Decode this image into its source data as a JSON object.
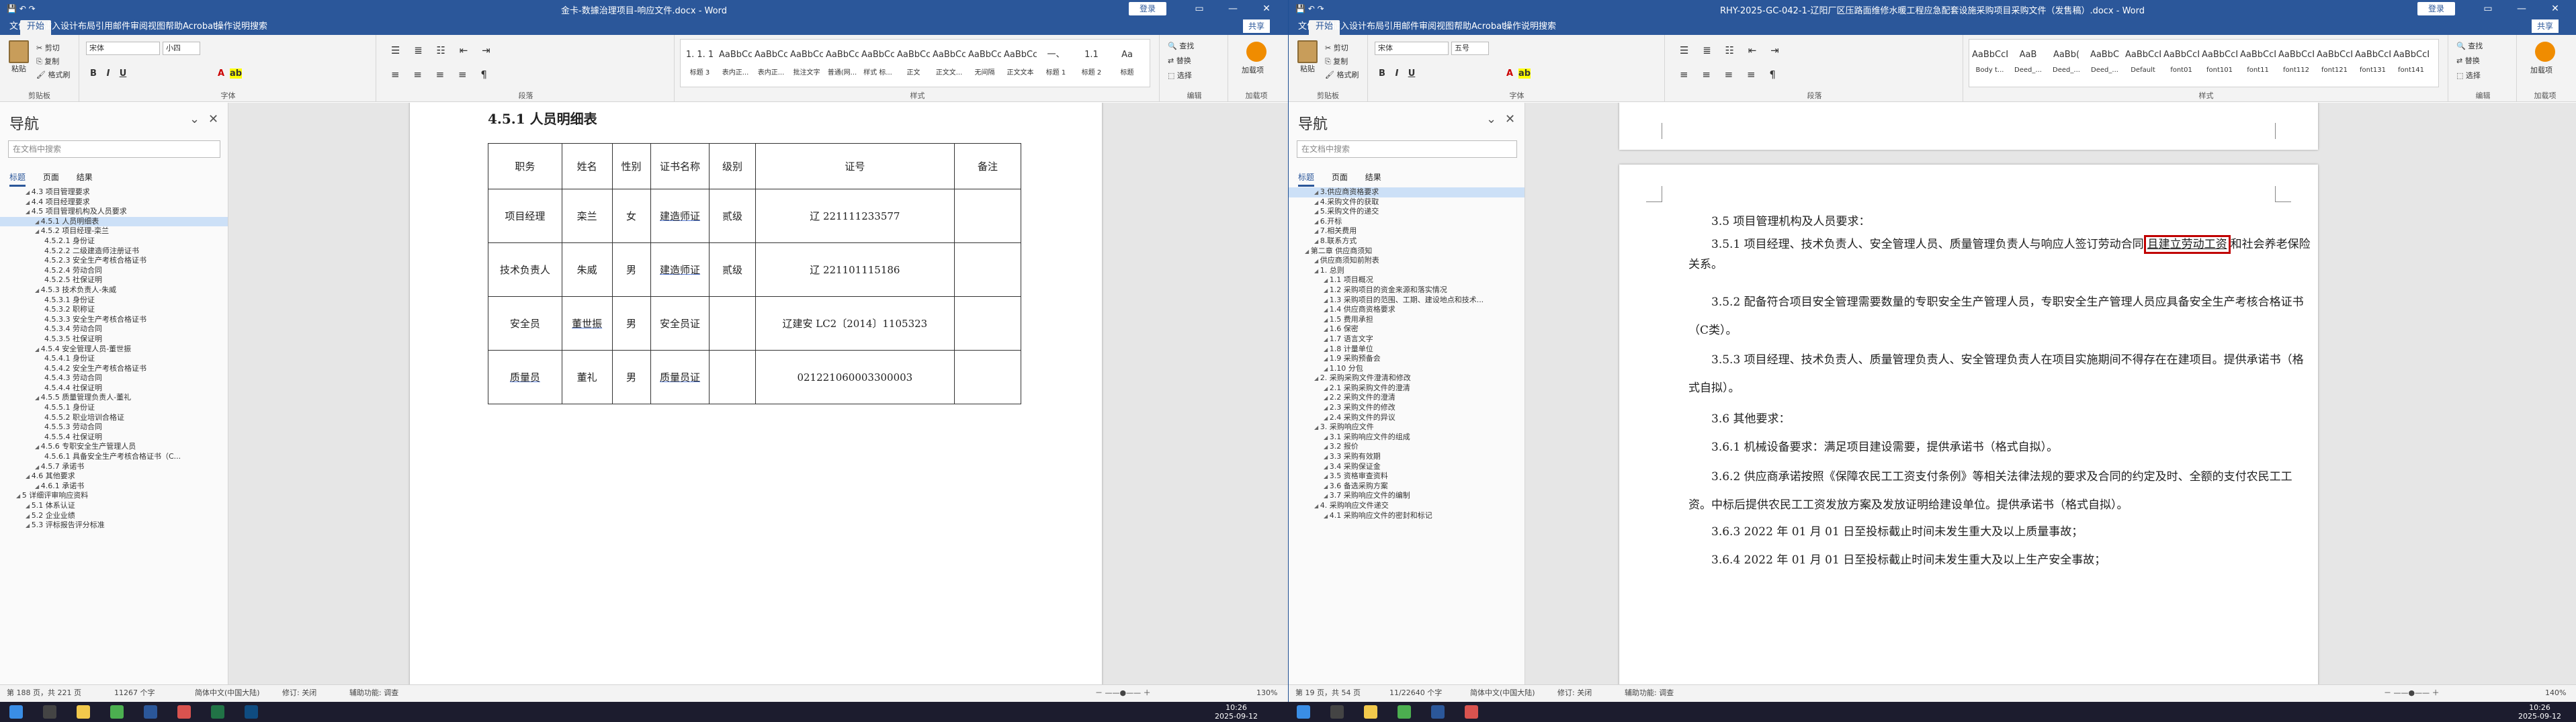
{
  "w1": {
    "title": "金卡-数據治理项目-响应文件.docx  -  Word",
    "login": "登录",
    "share": "共享",
    "tabs": [
      "文件",
      "开始",
      "插入",
      "设计",
      "布局",
      "引用",
      "邮件",
      "审阅",
      "视图",
      "帮助",
      "Acrobat",
      "操作说明搜索"
    ],
    "clipboard": {
      "paste": "粘贴",
      "cut": "剪切",
      "copy": "复制",
      "format_painter": "格式刷",
      "label": "剪贴板"
    },
    "font": {
      "name": "宋体",
      "size": "小四",
      "label": "字体"
    },
    "paragraph_label": "段落",
    "styles": [
      {
        "sample": "1. 1. 1",
        "name": "标题 3"
      },
      {
        "sample": "AaBbCcC",
        "name": "表内正..."
      },
      {
        "sample": "AaBbCcDd",
        "name": "表内正..."
      },
      {
        "sample": "AaBbCcDd",
        "name": "批注文字"
      },
      {
        "sample": "AaBbCcDd",
        "name": "普通(网..."
      },
      {
        "sample": "AaBbCcDd",
        "name": "样式 标..."
      },
      {
        "sample": "AaBbCcDd",
        "name": "正文"
      },
      {
        "sample": "AaBbCcDd",
        "name": "正文文..."
      },
      {
        "sample": "AaBbCcDd",
        "name": "无间隔"
      },
      {
        "sample": "AaBbCcDd",
        "name": "正文文本"
      },
      {
        "sample": "一、",
        "name": "标题 1"
      },
      {
        "sample": "1.1",
        "name": "标题 2"
      },
      {
        "sample": "Aa",
        "name": "标题"
      }
    ],
    "styles_label": "样式",
    "editing": {
      "find": "查找",
      "replace": "替换",
      "select": "选择",
      "label": "编辑"
    },
    "addin": {
      "name": "加载项",
      "label": "加载项"
    },
    "nav": {
      "title": "导航",
      "search_placeholder": "在文档中搜索",
      "tabs": [
        "标题",
        "页面",
        "结果"
      ],
      "items": [
        {
          "text": "4.3 项目管理要求",
          "level": 2
        },
        {
          "text": "4.4 项目经理要求",
          "level": 2
        },
        {
          "text": "4.5 项目管理机构及人员要求",
          "level": 2
        },
        {
          "text": "4.5.1 人员明细表",
          "level": 3,
          "selected": true
        },
        {
          "text": "4.5.2 项目经理-栾兰",
          "level": 3
        },
        {
          "text": "4.5.2.1 身份证",
          "level": 4
        },
        {
          "text": "4.5.2.2 二级建造师注册证书",
          "level": 4
        },
        {
          "text": "4.5.2.3 安全生产考核合格证书",
          "level": 4
        },
        {
          "text": "4.5.2.4 劳动合同",
          "level": 4
        },
        {
          "text": "4.5.2.5 社保证明",
          "level": 4
        },
        {
          "text": "4.5.3 技术负责人-朱威",
          "level": 3
        },
        {
          "text": "4.5.3.1 身份证",
          "level": 4
        },
        {
          "text": "4.5.3.2 职称证",
          "level": 4
        },
        {
          "text": "4.5.3.3 安全生产考核合格证书",
          "level": 4
        },
        {
          "text": "4.5.3.4 劳动合同",
          "level": 4
        },
        {
          "text": "4.5.3.5 社保证明",
          "level": 4
        },
        {
          "text": "4.5.4 安全管理人员-董世振",
          "level": 3
        },
        {
          "text": "4.5.4.1 身份证",
          "level": 4
        },
        {
          "text": "4.5.4.2 安全生产考核合格证书",
          "level": 4
        },
        {
          "text": "4.5.4.3 劳动合同",
          "level": 4
        },
        {
          "text": "4.5.4.4 社保证明",
          "level": 4
        },
        {
          "text": "4.5.5 质量管理负责人-董礼",
          "level": 3
        },
        {
          "text": "4.5.5.1 身份证",
          "level": 4
        },
        {
          "text": "4.5.5.2 职业培训合格证",
          "level": 4
        },
        {
          "text": "4.5.5.3 劳动合同",
          "level": 4
        },
        {
          "text": "4.5.5.4 社保证明",
          "level": 4
        },
        {
          "text": "4.5.6 专职安全生产管理人员",
          "level": 3
        },
        {
          "text": "4.5.6.1 具备安全生产考核合格证书（C...",
          "level": 4
        },
        {
          "text": "4.5.7 承诺书",
          "level": 3
        },
        {
          "text": "4.6 其他要求",
          "level": 2
        },
        {
          "text": "4.6.1 承诺书",
          "level": 3
        },
        {
          "text": "5 详细评审响应资料",
          "level": 1
        },
        {
          "text": "5.1 体系认证",
          "level": 2
        },
        {
          "text": "5.2 企业业绩",
          "level": 2
        },
        {
          "text": "5.3 评标报告评分标准",
          "level": 2
        }
      ]
    },
    "doc": {
      "heading": "4.5.1  人员明细表",
      "columns": [
        "职务",
        "姓名",
        "性别",
        "证书名称",
        "级别",
        "证号",
        "备注"
      ],
      "rows": [
        [
          "项目经理",
          "栾兰",
          "女",
          "建造师证",
          "贰级",
          "辽 221111233577",
          ""
        ],
        [
          "技术负责人",
          "朱威",
          "男",
          "建造师证",
          "贰级",
          "辽 221101115186",
          ""
        ],
        [
          "安全员",
          "董世振",
          "男",
          "安全员证",
          "",
          "辽建安 LC2〔2014〕1105323",
          ""
        ],
        [
          "质量员",
          "董礼",
          "男",
          "质量员证",
          "",
          "021221060003300003",
          ""
        ]
      ]
    },
    "status": {
      "page": "第 188 页，共 221 页",
      "words": "11267 个字",
      "lang": "简体中文(中国大陆)",
      "revision": "修订: 关闭",
      "access": "辅助功能: 调查",
      "zoom": "130%"
    }
  },
  "w2": {
    "title": "RHY-2025-GC-042-1-辽阳厂区压路面维修水暖工程应急配套设施采购项目采购文件（发售稿）.docx  -  Word",
    "login": "登录",
    "share": "共享",
    "tabs": [
      "文件",
      "开始",
      "插入",
      "设计",
      "布局",
      "引用",
      "邮件",
      "审阅",
      "视图",
      "帮助",
      "Acrobat",
      "操作说明搜索"
    ],
    "clipboard": {
      "paste": "粘贴",
      "cut": "剪切",
      "copy": "复制",
      "format_painter": "格式刷",
      "label": "剪贴板"
    },
    "font": {
      "name": "宋体",
      "size": "五号",
      "label": "字体"
    },
    "paragraph_label": "段落",
    "styles": [
      {
        "sample": "AaBbCcDdEe",
        "name": "Body t..."
      },
      {
        "sample": "AaB",
        "name": "Deed_..."
      },
      {
        "sample": "AaBb(",
        "name": "Deed_..."
      },
      {
        "sample": "AaBbC",
        "name": "Deed_..."
      },
      {
        "sample": "AaBbCcDc",
        "name": "Default"
      },
      {
        "sample": "AaBbCcDd",
        "name": "font01"
      },
      {
        "sample": "AaBbCcDd",
        "name": "font101"
      },
      {
        "sample": "AaBbCcDd",
        "name": "font11"
      },
      {
        "sample": "AaBbCcI",
        "name": "font112"
      },
      {
        "sample": "AaBbCcI",
        "name": "font121"
      },
      {
        "sample": "AaBbCcDc",
        "name": "font131"
      },
      {
        "sample": "AaBbCcDc",
        "name": "font141"
      }
    ],
    "styles_label": "样式",
    "editing": {
      "find": "查找",
      "replace": "替换",
      "select": "选择",
      "label": "编辑"
    },
    "addin": {
      "name": "加载项",
      "label": "加载项"
    },
    "nav": {
      "title": "导航",
      "search_placeholder": "在文档中搜索",
      "tabs": [
        "标题",
        "页面",
        "结果"
      ],
      "items": [
        {
          "text": "3.供应商资格要求",
          "level": 2,
          "selected": true
        },
        {
          "text": "4.采购文件的获取",
          "level": 2
        },
        {
          "text": "5.采购文件的递交",
          "level": 2
        },
        {
          "text": "6.开标",
          "level": 2
        },
        {
          "text": "7.相关费用",
          "level": 2
        },
        {
          "text": "8.联系方式",
          "level": 2
        },
        {
          "text": "第二章  供应商须知",
          "level": 1
        },
        {
          "text": "供应商须知前附表",
          "level": 2
        },
        {
          "text": "1. 总则",
          "level": 2
        },
        {
          "text": "1.1 项目概况",
          "level": 3
        },
        {
          "text": "1.2 采购项目的资金来源和落实情况",
          "level": 3
        },
        {
          "text": "1.3 采购项目的范围、工期、建设地点和技术...",
          "level": 3
        },
        {
          "text": "1.4 供应商资格要求",
          "level": 3
        },
        {
          "text": "1.5 费用承担",
          "level": 3
        },
        {
          "text": "1.6 保密",
          "level": 3
        },
        {
          "text": "1.7 语言文字",
          "level": 3
        },
        {
          "text": "1.8 计量单位",
          "level": 3
        },
        {
          "text": "1.9 采购预备会",
          "level": 3
        },
        {
          "text": "1.10 分包",
          "level": 3
        },
        {
          "text": "2. 采购采购文件澄清和修改",
          "level": 2
        },
        {
          "text": "2.1 采购采购文件的澄清",
          "level": 3
        },
        {
          "text": "2.2 采购文件的澄清",
          "level": 3
        },
        {
          "text": "2.3 采购文件的修改",
          "level": 3
        },
        {
          "text": "2.4 采购文件的异议",
          "level": 3
        },
        {
          "text": "3. 采购响应文件",
          "level": 2
        },
        {
          "text": "3.1 采购响应文件的组成",
          "level": 3
        },
        {
          "text": "3.2 报价",
          "level": 3
        },
        {
          "text": "3.3 采购有效期",
          "level": 3
        },
        {
          "text": "3.4 采购保证金",
          "level": 3
        },
        {
          "text": "3.5 资格审查资料",
          "level": 3
        },
        {
          "text": "3.6 备选采购方案",
          "level": 3
        },
        {
          "text": "3.7 采购响应文件的编制",
          "level": 3
        },
        {
          "text": "4. 采购响应文件递交",
          "level": 2
        },
        {
          "text": "4.1 采购响应文件的密封和标记",
          "level": 3
        }
      ]
    },
    "doc": {
      "p1": "3.5 项目管理机构及人员要求：",
      "p2a": "3.5.1 项目经理、技术负责人、安全管理人员、质量管理负责人与响应人签订劳动合同",
      "p2b": "且建立劳动工资",
      "p2c": "和社会养老保险关系。",
      "p3": "3.5.2 配备符合项目安全管理需要数量的专职安全生产管理人员，专职安全生产管理人员应具备安全生产考核合格证书（C类）。",
      "p4": "3.5.3 项目经理、技术负责人、质量管理负责人、安全管理负责人在项目实施期间不得存在在建项目。提供承诺书（格式自拟）。",
      "p5": "3.6 其他要求：",
      "p6": "3.6.1 机械设备要求：满足项目建设需要，提供承诺书（格式自拟）。",
      "p7": "3.6.2 供应商承诺按照《保障农民工工资支付条例》等相关法律法规的要求及合同的约定及时、全额的支付农民工工资。中标后提供农民工工资发放方案及发放证明给建设单位。提供承诺书（格式自拟）。",
      "p8": "3.6.3 2022 年 01 月 01 日至投标截止时间未发生重大及以上质量事故；",
      "p9": "3.6.4 2022 年 01 月 01 日至投标截止时间未发生重大及以上生产安全事故；"
    },
    "status": {
      "page": "第 19 页，共 54 页",
      "words": "11/22640 个字",
      "lang": "简体中文(中国大陆)",
      "revision": "修订: 关闭",
      "access": "辅助功能: 调查",
      "zoom": "140%"
    }
  },
  "taskbar": {
    "clock1_time": "10:26",
    "clock1_date": "2025-09-12",
    "clock2_time": "10:26",
    "clock2_date": "2025-09-12"
  }
}
